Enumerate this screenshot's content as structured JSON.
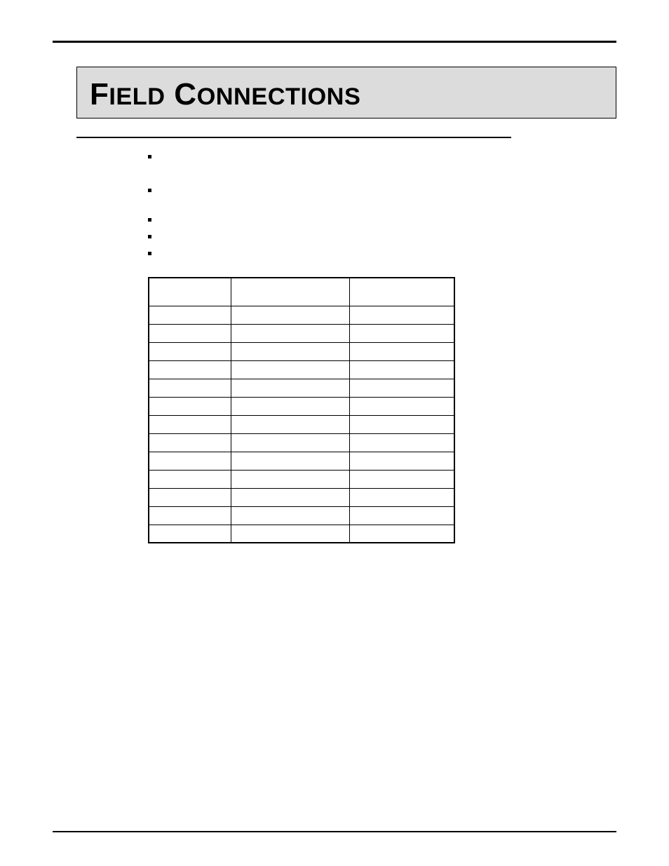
{
  "title": {
    "word1_first": "F",
    "word1_rest": "IELD",
    "space": " ",
    "word2_first": "C",
    "word2_rest": "ONNECTIONS"
  },
  "subhead": "",
  "intro": "",
  "bullets": [
    "",
    "",
    "",
    "",
    ""
  ],
  "table": {
    "headers": [
      "",
      "",
      ""
    ],
    "rows": [
      [
        "",
        "",
        ""
      ],
      [
        "",
        "",
        ""
      ],
      [
        "",
        "",
        ""
      ],
      [
        "",
        "",
        ""
      ],
      [
        "",
        "",
        ""
      ],
      [
        "",
        "",
        ""
      ],
      [
        "",
        "",
        ""
      ],
      [
        "",
        "",
        ""
      ],
      [
        "",
        "",
        ""
      ],
      [
        "",
        "",
        ""
      ],
      [
        "",
        "",
        ""
      ],
      [
        "",
        "",
        ""
      ],
      [
        "",
        "",
        ""
      ]
    ]
  },
  "page_num": ""
}
